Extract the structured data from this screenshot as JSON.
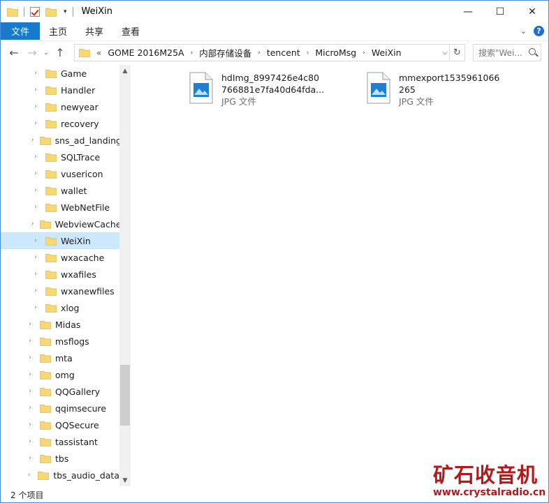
{
  "window": {
    "title": "WeiXin",
    "controls": {
      "minimize": "—",
      "maximize": "☐",
      "close": "✕"
    }
  },
  "ribbon": {
    "file_tab": "文件",
    "tabs": [
      "主页",
      "共享",
      "查看"
    ],
    "help": "?"
  },
  "nav": {
    "back": "←",
    "forward": "→",
    "recent": "⌄",
    "up": "↑"
  },
  "address": {
    "overflow": "«",
    "breadcrumbs": [
      "GOME 2016M25A",
      "内部存储设备",
      "tencent",
      "MicroMsg",
      "WeiXin"
    ],
    "separator": "›",
    "refresh": "↻"
  },
  "search": {
    "placeholder": "搜索\"Wei..."
  },
  "tree": {
    "items": [
      {
        "label": "Game",
        "level": 2
      },
      {
        "label": "Handler",
        "level": 2
      },
      {
        "label": "newyear",
        "level": 2
      },
      {
        "label": "recovery",
        "level": 2
      },
      {
        "label": "sns_ad_landing",
        "level": 2
      },
      {
        "label": "SQLTrace",
        "level": 2
      },
      {
        "label": "vusericon",
        "level": 2
      },
      {
        "label": "wallet",
        "level": 2
      },
      {
        "label": "WebNetFile",
        "level": 2
      },
      {
        "label": "WebviewCache",
        "level": 2
      },
      {
        "label": "WeiXin",
        "level": 2,
        "selected": true
      },
      {
        "label": "wxacache",
        "level": 2
      },
      {
        "label": "wxafiles",
        "level": 2
      },
      {
        "label": "wxanewfiles",
        "level": 2
      },
      {
        "label": "xlog",
        "level": 2
      },
      {
        "label": "Midas",
        "level": 1
      },
      {
        "label": "msflogs",
        "level": 1
      },
      {
        "label": "mta",
        "level": 1
      },
      {
        "label": "omg",
        "level": 1
      },
      {
        "label": "QQGallery",
        "level": 1
      },
      {
        "label": "qqimsecure",
        "level": 1
      },
      {
        "label": "QQSecure",
        "level": 1
      },
      {
        "label": "tassistant",
        "level": 1
      },
      {
        "label": "tbs",
        "level": 1
      },
      {
        "label": "tbs_audio_data",
        "level": 1
      }
    ]
  },
  "files": [
    {
      "name": "hdImg_8997426e4c80\n766881e7fa40d64fda...",
      "type": "JPG 文件"
    },
    {
      "name": "mmexport1535961066\n265",
      "type": "JPG 文件"
    }
  ],
  "status": {
    "count": "2 个项目"
  },
  "watermark": {
    "title": "矿石收音机",
    "url": "www.crystalradio.cn"
  }
}
